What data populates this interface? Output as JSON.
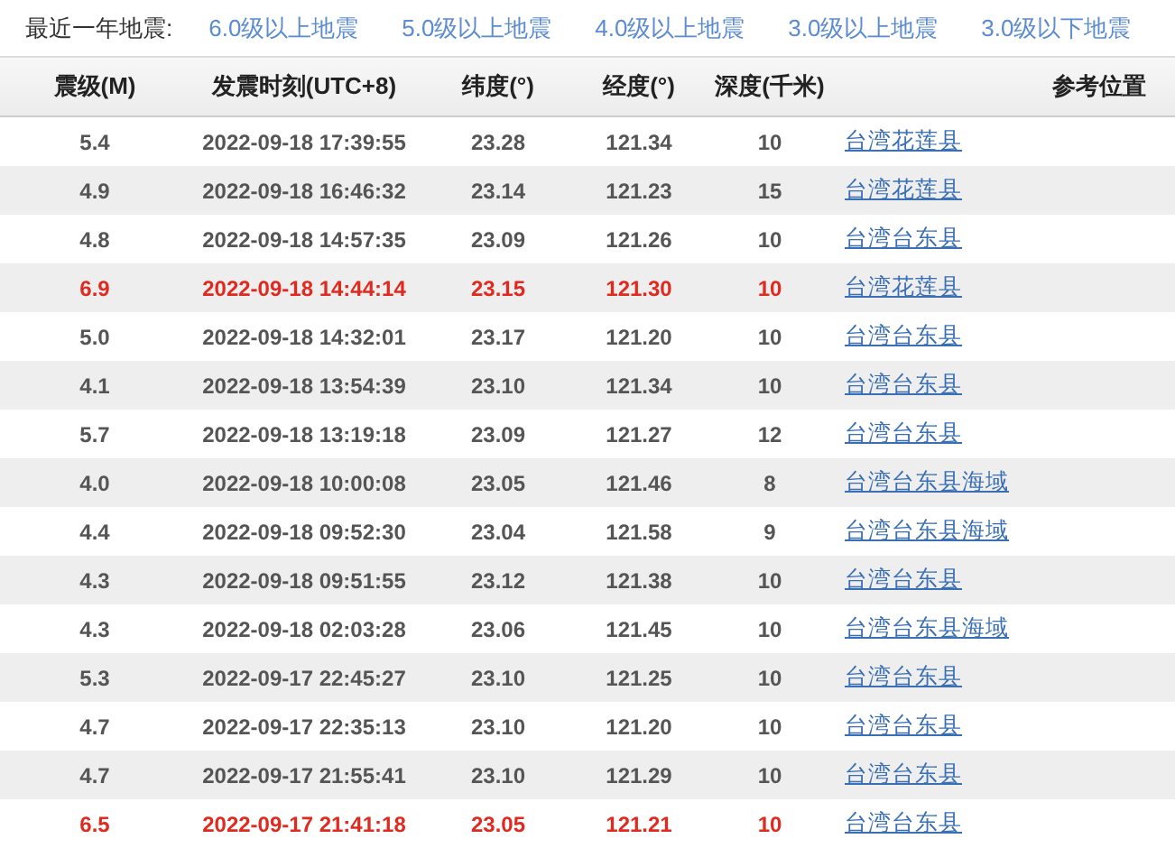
{
  "filter_bar": {
    "label": "最近一年地震:",
    "links": [
      "6.0级以上地震",
      "5.0级以上地震",
      "4.0级以上地震",
      "3.0级以上地震",
      "3.0级以下地震"
    ]
  },
  "table": {
    "columns": [
      "震级(M)",
      "发震时刻(UTC+8)",
      "纬度(°)",
      "经度(°)",
      "深度(千米)",
      "参考位置"
    ],
    "rows": [
      {
        "magnitude": "5.4",
        "time": "2022-09-18 17:39:55",
        "latitude": "23.28",
        "longitude": "121.34",
        "depth": "10",
        "location": "台湾花莲县",
        "major": false
      },
      {
        "magnitude": "4.9",
        "time": "2022-09-18 16:46:32",
        "latitude": "23.14",
        "longitude": "121.23",
        "depth": "15",
        "location": "台湾花莲县",
        "major": false
      },
      {
        "magnitude": "4.8",
        "time": "2022-09-18 14:57:35",
        "latitude": "23.09",
        "longitude": "121.26",
        "depth": "10",
        "location": "台湾台东县",
        "major": false
      },
      {
        "magnitude": "6.9",
        "time": "2022-09-18 14:44:14",
        "latitude": "23.15",
        "longitude": "121.30",
        "depth": "10",
        "location": "台湾花莲县",
        "major": true
      },
      {
        "magnitude": "5.0",
        "time": "2022-09-18 14:32:01",
        "latitude": "23.17",
        "longitude": "121.20",
        "depth": "10",
        "location": "台湾台东县",
        "major": false
      },
      {
        "magnitude": "4.1",
        "time": "2022-09-18 13:54:39",
        "latitude": "23.10",
        "longitude": "121.34",
        "depth": "10",
        "location": "台湾台东县",
        "major": false
      },
      {
        "magnitude": "5.7",
        "time": "2022-09-18 13:19:18",
        "latitude": "23.09",
        "longitude": "121.27",
        "depth": "12",
        "location": "台湾台东县",
        "major": false
      },
      {
        "magnitude": "4.0",
        "time": "2022-09-18 10:00:08",
        "latitude": "23.05",
        "longitude": "121.46",
        "depth": "8",
        "location": "台湾台东县海域",
        "major": false
      },
      {
        "magnitude": "4.4",
        "time": "2022-09-18 09:52:30",
        "latitude": "23.04",
        "longitude": "121.58",
        "depth": "9",
        "location": "台湾台东县海域",
        "major": false
      },
      {
        "magnitude": "4.3",
        "time": "2022-09-18 09:51:55",
        "latitude": "23.12",
        "longitude": "121.38",
        "depth": "10",
        "location": "台湾台东县",
        "major": false
      },
      {
        "magnitude": "4.3",
        "time": "2022-09-18 02:03:28",
        "latitude": "23.06",
        "longitude": "121.45",
        "depth": "10",
        "location": "台湾台东县海域",
        "major": false
      },
      {
        "magnitude": "5.3",
        "time": "2022-09-17 22:45:27",
        "latitude": "23.10",
        "longitude": "121.25",
        "depth": "10",
        "location": "台湾台东县",
        "major": false
      },
      {
        "magnitude": "4.7",
        "time": "2022-09-17 22:35:13",
        "latitude": "23.10",
        "longitude": "121.20",
        "depth": "10",
        "location": "台湾台东县",
        "major": false
      },
      {
        "magnitude": "4.7",
        "time": "2022-09-17 21:55:41",
        "latitude": "23.10",
        "longitude": "121.29",
        "depth": "10",
        "location": "台湾台东县",
        "major": false
      },
      {
        "magnitude": "6.5",
        "time": "2022-09-17 21:41:18",
        "latitude": "23.05",
        "longitude": "121.21",
        "depth": "10",
        "location": "台湾台东县",
        "major": true
      }
    ]
  }
}
